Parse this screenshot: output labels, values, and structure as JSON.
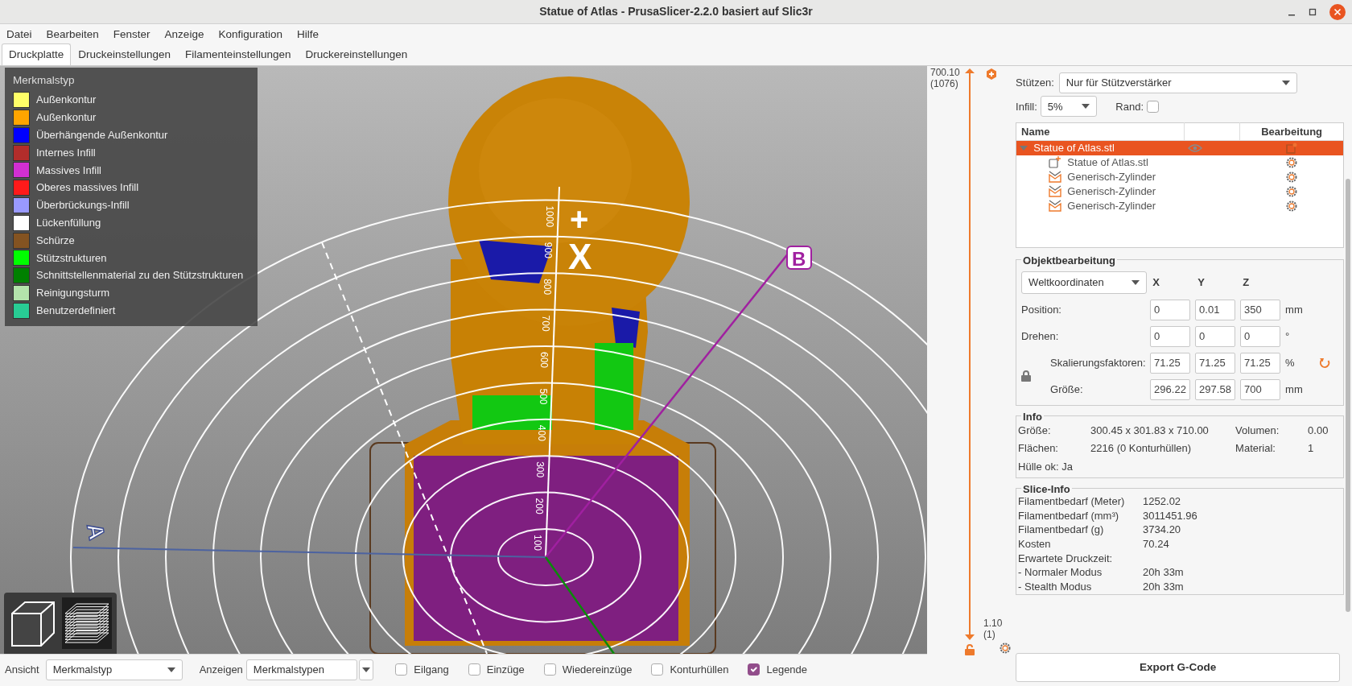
{
  "window": {
    "title": "Statue of Atlas - PrusaSlicer-2.2.0 basiert auf Slic3r"
  },
  "menu": [
    "Datei",
    "Bearbeiten",
    "Fenster",
    "Anzeige",
    "Konfiguration",
    "Hilfe"
  ],
  "tabs": [
    {
      "label": "Druckplatte",
      "selected": true
    },
    {
      "label": "Druckeinstellungen",
      "selected": false
    },
    {
      "label": "Filamenteinstellungen",
      "selected": false
    },
    {
      "label": "Druckereinstellungen",
      "selected": false
    }
  ],
  "legend": {
    "title": "Merkmalstyp",
    "items": [
      {
        "label": "Außenkontur",
        "color": "#ffff68"
      },
      {
        "label": "Außenkontur",
        "color": "#ffa500"
      },
      {
        "label": "Überhängende Außenkontur",
        "color": "#0000ff"
      },
      {
        "label": "Internes Infill",
        "color": "#b22d2b"
      },
      {
        "label": "Massives Infill",
        "color": "#d22fd2"
      },
      {
        "label": "Oberes massives Infill",
        "color": "#ff1a1a"
      },
      {
        "label": "Überbrückungs-Infill",
        "color": "#9999ff"
      },
      {
        "label": "Lückenfüllung",
        "color": "#ffffff"
      },
      {
        "label": "Schürze",
        "color": "#845321"
      },
      {
        "label": "Stützstrukturen",
        "color": "#00ff00"
      },
      {
        "label": "Schnittstellenmaterial zu den Stützstrukturen",
        "color": "#008000"
      },
      {
        "label": "Reinigungsturm",
        "color": "#b3e3ab"
      },
      {
        "label": "Benutzerdefiniert",
        "color": "#28cc94"
      }
    ]
  },
  "scene": {
    "ring_labels": [
      "100",
      "200",
      "300",
      "400",
      "500",
      "600",
      "700",
      "800",
      "900",
      "1000"
    ],
    "axis_a": "A",
    "axis_b": "B",
    "axis_x": "X",
    "axis_x_sign": "+"
  },
  "layer_slider": {
    "top_value": "700.10",
    "top_layer": "(1076)",
    "bottom_value": "1.10",
    "bottom_layer": "(1)"
  },
  "settings": {
    "supports": {
      "label": "Stützen:",
      "value": "Nur für Stützverstärker"
    },
    "infill": {
      "label": "Infill:",
      "value": "5%"
    },
    "brim": {
      "label": "Rand:",
      "checked": false
    }
  },
  "object_list": {
    "columns": [
      "Name",
      "Bearbeitung"
    ],
    "items": [
      {
        "name": "Statue of Atlas.stl",
        "kind": "object",
        "selected": true,
        "expanded": true,
        "children": [
          {
            "name": "Statue of Atlas.stl",
            "kind": "part",
            "selected": false
          },
          {
            "name": "Generisch-Zylinder",
            "kind": "modifier",
            "selected": false
          },
          {
            "name": "Generisch-Zylinder",
            "kind": "modifier",
            "selected": false
          },
          {
            "name": "Generisch-Zylinder",
            "kind": "modifier",
            "selected": false
          }
        ]
      }
    ]
  },
  "object_manipulation": {
    "title": "Objektbearbeitung",
    "coordinates": "Weltkoordinaten",
    "axes": [
      "X",
      "Y",
      "Z"
    ],
    "rows": [
      {
        "kind": "basic",
        "label": "Position:",
        "values": [
          "0",
          "0.01",
          "350"
        ],
        "unit": "mm"
      },
      {
        "kind": "basic",
        "label": "Drehen:",
        "values": [
          "0",
          "0",
          "0"
        ],
        "unit": "°"
      },
      {
        "kind": "scaling",
        "label": "Skalierungsfaktoren:",
        "values": [
          "71.25",
          "71.25",
          "71.25"
        ],
        "unit": "%",
        "reset_button": true
      },
      {
        "kind": "scaling",
        "label": "Größe:",
        "values": [
          "296.22",
          "297.58",
          "700"
        ],
        "unit": "mm"
      }
    ]
  },
  "info": {
    "title": "Info",
    "rows": [
      [
        {
          "label": "Größe:",
          "value": "300.45 x 301.83 x 710.00"
        },
        {
          "label": "Volumen:",
          "value": "0.00"
        }
      ],
      [
        {
          "label": "Flächen:",
          "value": "2216 (0 Konturhüllen)"
        },
        {
          "label": "Material:",
          "value": "1"
        }
      ],
      [
        {
          "label": "Hülle ok:",
          "value": "Ja"
        }
      ]
    ]
  },
  "slice_info": {
    "title": "Slice-Info",
    "rows": [
      {
        "label": "Filamentbedarf (Meter)",
        "value": "1252.02"
      },
      {
        "label": "Filamentbedarf (mm³)",
        "value": "3011451.96"
      },
      {
        "label": "Filamentbedarf (g)",
        "value": "3734.20"
      },
      {
        "label": "Kosten",
        "value": "70.24"
      },
      {
        "label": "Erwartete Druckzeit:"
      },
      {
        "label": "- Normaler Modus",
        "value": "20h 33m"
      },
      {
        "label": "- Stealth Modus",
        "value": "20h 33m"
      }
    ]
  },
  "export_button": "Export G-Code",
  "bottom_bar": {
    "view": {
      "label": "Ansicht",
      "value": "Merkmalstyp"
    },
    "show": {
      "label": "Anzeigen",
      "value": "Merkmalstypen"
    },
    "options": [
      {
        "label": "Eilgang",
        "checked": false
      },
      {
        "label": "Einzüge",
        "checked": false
      },
      {
        "label": "Wiedereinzüge",
        "checked": false
      },
      {
        "label": "Konturhüllen",
        "checked": false
      },
      {
        "label": "Legende",
        "checked": true
      }
    ]
  }
}
